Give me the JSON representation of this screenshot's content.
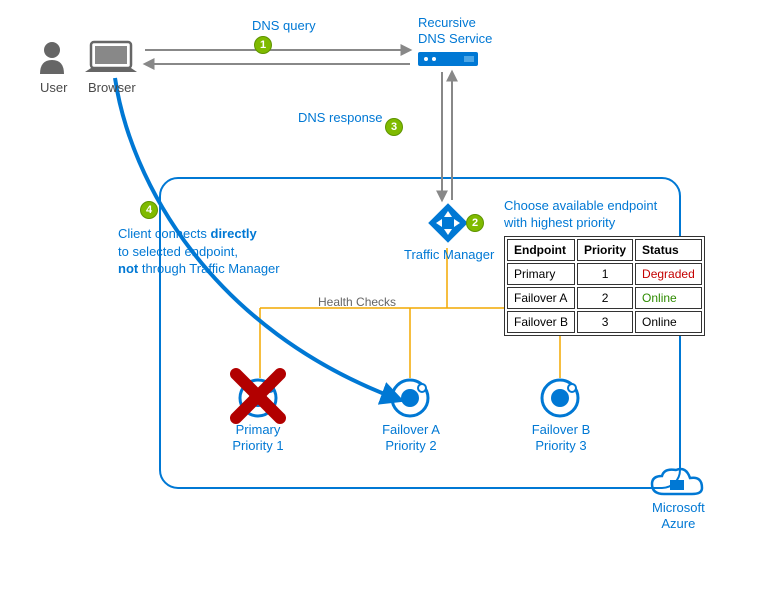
{
  "labels": {
    "user": "User",
    "browser": "Browser",
    "dns_query": "DNS query",
    "recursive_dns": "Recursive\nDNS Service",
    "dns_response": "DNS response",
    "traffic_manager": "Traffic Manager",
    "choose_line1": "Choose available endpoint",
    "choose_line2": "with highest priority",
    "client_connects_l1_pre": "Client connects ",
    "client_connects_l1_bold": "directly",
    "client_connects_l2": "to selected endpoint,",
    "client_connects_l3_bold": "not",
    "client_connects_l3_post": " through Traffic Manager",
    "health_checks": "Health Checks",
    "azure": "Microsoft\nAzure"
  },
  "steps": {
    "s1": "1",
    "s2": "2",
    "s3": "3",
    "s4": "4"
  },
  "endpoints": {
    "primary": {
      "name": "Primary",
      "priority_label": "Priority 1"
    },
    "failoverA": {
      "name": "Failover A",
      "priority_label": "Priority 2"
    },
    "failoverB": {
      "name": "Failover B",
      "priority_label": "Priority 3"
    }
  },
  "table": {
    "headers": {
      "endpoint": "Endpoint",
      "priority": "Priority",
      "status": "Status"
    },
    "rows": [
      {
        "endpoint": "Primary",
        "priority": "1",
        "status": "Degraded",
        "status_class": "red"
      },
      {
        "endpoint": "Failover A",
        "priority": "2",
        "status": "Online",
        "status_class": "green"
      },
      {
        "endpoint": "Failover B",
        "priority": "3",
        "status": "Online",
        "status_class": ""
      }
    ]
  }
}
